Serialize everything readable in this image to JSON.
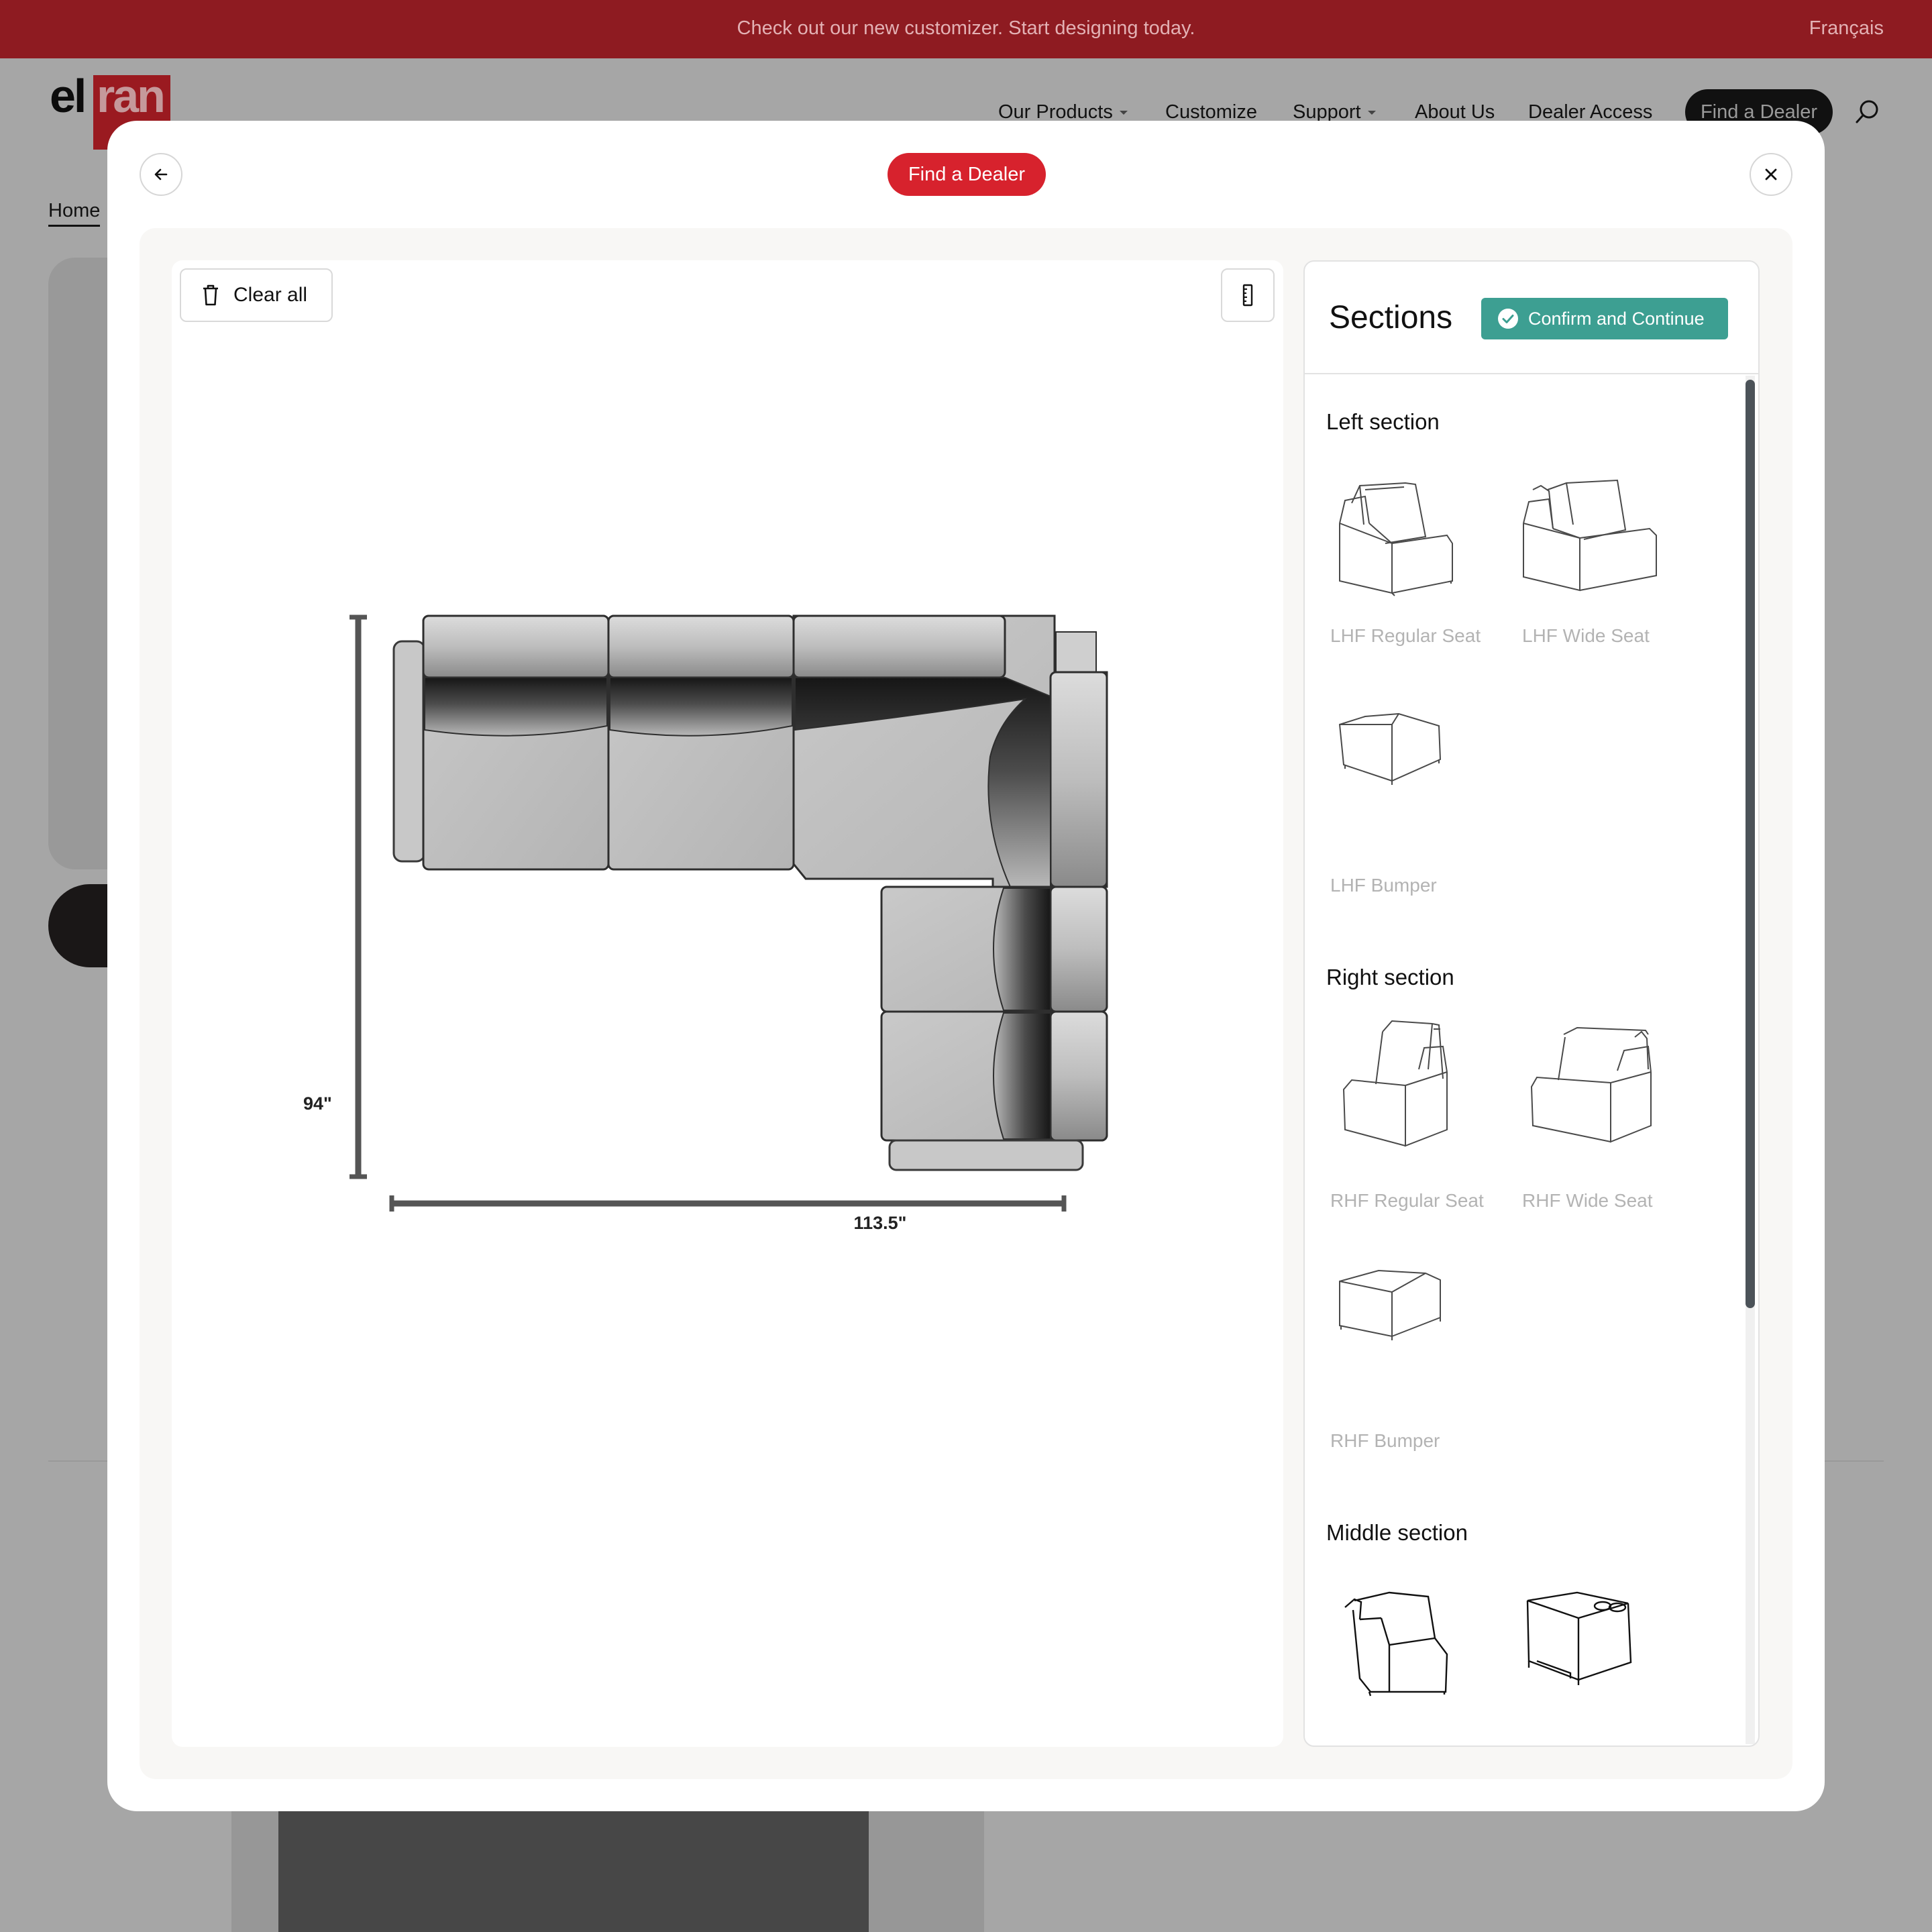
{
  "promo": {
    "text": "Check out our new customizer. Start designing today.",
    "language": "Français"
  },
  "header": {
    "logo": {
      "part1": "el",
      "part2": "ran"
    },
    "nav": [
      {
        "label": "Our Products",
        "has_menu": true
      },
      {
        "label": "Customize",
        "has_menu": false
      },
      {
        "label": "Support",
        "has_menu": true
      },
      {
        "label": "About Us",
        "has_menu": false
      },
      {
        "label": "Dealer Access",
        "has_menu": false
      }
    ],
    "find_dealer": "Find a Dealer",
    "search_icon": "search-icon"
  },
  "background": {
    "breadcrumb_home": "Home"
  },
  "modal": {
    "find_dealer": "Find a Dealer",
    "back_icon": "arrow-left-icon",
    "close_icon": "close-icon",
    "toolbar": {
      "clear_all": "Clear all",
      "clear_icon": "trash-icon",
      "measure_icon": "ruler-icon"
    },
    "plan": {
      "width_label": "113.5\"",
      "depth_label": "94\""
    },
    "panel": {
      "title": "Sections",
      "confirm": "Confirm and Continue",
      "confirm_icon": "check-circle-icon",
      "groups": [
        {
          "title": "Left section",
          "items": [
            "LHF Regular Seat",
            "LHF Wide Seat",
            "LHF Bumper"
          ]
        },
        {
          "title": "Right section",
          "items": [
            "RHF Regular Seat",
            "RHF Wide Seat",
            "RHF Bumper"
          ]
        },
        {
          "title": "Middle section",
          "items": [
            "",
            ""
          ]
        }
      ]
    }
  },
  "colors": {
    "promo_bg": "#8e1b21",
    "accent_red": "#d7222d",
    "confirm_teal": "#3d9f92",
    "overlay": "#a6a6a6"
  }
}
